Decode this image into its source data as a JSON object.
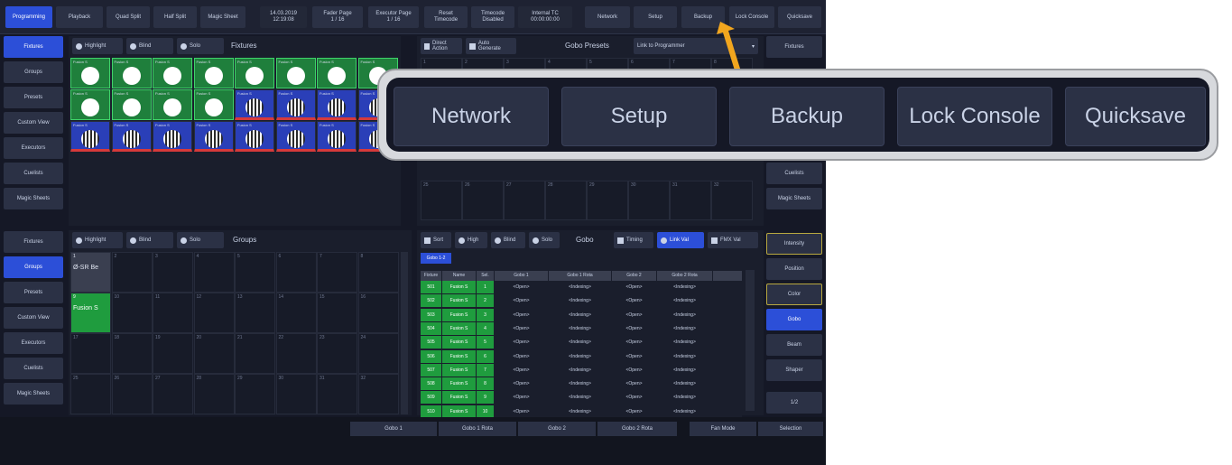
{
  "topbar": {
    "programming": "Programming",
    "playback": "Playback",
    "quad_split": "Quad Split",
    "half_split": "Half Split",
    "magic_sheet": "Magic Sheet",
    "date": "14.03.2019\n12:19:08",
    "fader_page": "Fader Page\n1 / 16",
    "executor_page": "Executor Page\n1 / 16",
    "reset_timecode": "Reset\nTimecode",
    "timecode": "Timecode\nDisabled",
    "internal_tc": "Internal TC\n00:00:00:00",
    "network": "Network",
    "setup": "Setup",
    "backup": "Backup",
    "lock_console": "Lock Console",
    "quicksave": "Quicksave"
  },
  "left_nav_top": [
    "Fixtures",
    "Groups",
    "Presets",
    "Custom View",
    "Executors",
    "Cuelists",
    "Magic Sheets"
  ],
  "left_nav_bottom": [
    "Fixtures",
    "Groups",
    "Presets",
    "Custom View",
    "Executors",
    "Cuelists",
    "Magic Sheets"
  ],
  "fixtures_panel": {
    "highlight": "Highlight",
    "blind": "Blind",
    "solo": "Solo",
    "title": "Fixtures",
    "tile_label": "Fusion S"
  },
  "groups_panel": {
    "highlight": "Highlight",
    "blind": "Blind",
    "solo": "Solo",
    "title": "Groups",
    "group1": "Ø-SR Be",
    "group2": "Fusion S",
    "nums": [
      "1",
      "2",
      "3",
      "4",
      "5",
      "6",
      "7",
      "8",
      "9",
      "10",
      "11",
      "12",
      "13",
      "14",
      "15",
      "16",
      "17",
      "18",
      "19",
      "20",
      "21",
      "22",
      "23",
      "24",
      "25",
      "26",
      "27",
      "28",
      "29",
      "30",
      "31",
      "32"
    ]
  },
  "presets_panel": {
    "direct_action": "Direct Action",
    "auto_generate": "Auto Generate",
    "title": "Gobo Presets",
    "link_programmer": "Link to Programmer",
    "nums_row1": [
      "1",
      "2",
      "3",
      "4",
      "5",
      "6",
      "7",
      "8"
    ],
    "nums_row2": [
      "25",
      "26",
      "27",
      "28",
      "29",
      "30",
      "31",
      "32"
    ]
  },
  "right_nav_top": [
    "Fixtures",
    "Cuelists",
    "Magic Sheets"
  ],
  "gobo_panel": {
    "sort": "Sort",
    "high": "High",
    "blind": "Blind",
    "solo": "Solo",
    "title": "Gobo",
    "timing": "Timing",
    "link_val": "Link Val",
    "fmx_val": "FMX Val",
    "tab": "Gobo 1-2",
    "headers": [
      "Fixture",
      "Name",
      "Sel.",
      "Gobo 1",
      "Gobo 1 Rota",
      "Gobo 2",
      "Gobo 2 Rota"
    ],
    "rows": [
      [
        "501",
        "Fusion S",
        "1",
        "<Open>",
        "<Indexing>",
        "<Open>",
        "<Indexing>"
      ],
      [
        "502",
        "Fusion S",
        "2",
        "<Open>",
        "<Indexing>",
        "<Open>",
        "<Indexing>"
      ],
      [
        "503",
        "Fusion S",
        "3",
        "<Open>",
        "<Indexing>",
        "<Open>",
        "<Indexing>"
      ],
      [
        "504",
        "Fusion S",
        "4",
        "<Open>",
        "<Indexing>",
        "<Open>",
        "<Indexing>"
      ],
      [
        "505",
        "Fusion S",
        "5",
        "<Open>",
        "<Indexing>",
        "<Open>",
        "<Indexing>"
      ],
      [
        "506",
        "Fusion S",
        "6",
        "<Open>",
        "<Indexing>",
        "<Open>",
        "<Indexing>"
      ],
      [
        "507",
        "Fusion S",
        "7",
        "<Open>",
        "<Indexing>",
        "<Open>",
        "<Indexing>"
      ],
      [
        "508",
        "Fusion S",
        "8",
        "<Open>",
        "<Indexing>",
        "<Open>",
        "<Indexing>"
      ],
      [
        "509",
        "Fusion S",
        "9",
        "<Open>",
        "<Indexing>",
        "<Open>",
        "<Indexing>"
      ],
      [
        "510",
        "Fusion S",
        "10",
        "<Open>",
        "<Indexing>",
        "<Open>",
        "<Indexing>"
      ]
    ]
  },
  "attr_nav": [
    "Intensity",
    "Position",
    "Color",
    "Gobo",
    "Beam",
    "Shaper",
    "1/2"
  ],
  "bottom_bar": [
    "Gobo 1",
    "Gobo 1 Rota",
    "Gobo 2",
    "Gobo 2 Rota",
    "Fan Mode",
    "Selection"
  ],
  "callout": {
    "network": "Network",
    "setup": "Setup",
    "backup": "Backup",
    "lock_console": "Lock Console",
    "quicksave": "Quicksave"
  },
  "colors": {
    "accent": "#2c4fd8",
    "selected_green": "#1f9c3e",
    "arrow": "#f2a61e"
  }
}
